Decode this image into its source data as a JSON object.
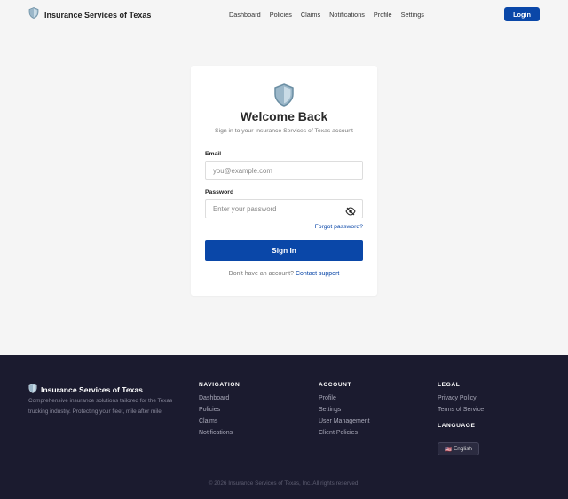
{
  "header": {
    "brand_title": "Insurance Services of Texas",
    "nav": [
      "Dashboard",
      "Policies",
      "Claims",
      "Notifications",
      "Profile",
      "Settings"
    ],
    "login_label": "Login"
  },
  "login": {
    "title": "Welcome Back",
    "subtitle": "Sign in to your Insurance Services of Texas account",
    "email_label": "Email",
    "email_placeholder": "you@example.com",
    "password_label": "Password",
    "password_placeholder": "Enter your password",
    "forgot_label": "Forgot password?",
    "signin_label": "Sign In",
    "no_account_text": "Don't have an account?",
    "contact_support_label": "Contact support"
  },
  "footer": {
    "brand_title": "Insurance Services of Texas",
    "description": "Comprehensive insurance solutions tailored for the Texas trucking industry. Protecting your fleet, mile after mile.",
    "navigation": {
      "heading": "NAVIGATION",
      "links": [
        "Dashboard",
        "Policies",
        "Claims",
        "Notifications"
      ]
    },
    "account": {
      "heading": "ACCOUNT",
      "links": [
        "Profile",
        "Settings",
        "User Management",
        "Client Policies"
      ]
    },
    "legal": {
      "heading": "LEGAL",
      "links": [
        "Privacy Policy",
        "Terms of Service"
      ]
    },
    "language": {
      "heading": "LANGUAGE",
      "flag": "🇺🇸",
      "current": "English"
    },
    "copyright": "© 2026 Insurance Services of Texas, Inc. All rights reserved."
  },
  "colors": {
    "primary": "#0a47a8",
    "footer_bg": "#1b1b2f",
    "page_bg": "#f5f5f5"
  },
  "icons": {
    "brand": "shield-icon",
    "password_toggle": "eye-slash-icon",
    "language_flag": "us-flag-icon"
  }
}
